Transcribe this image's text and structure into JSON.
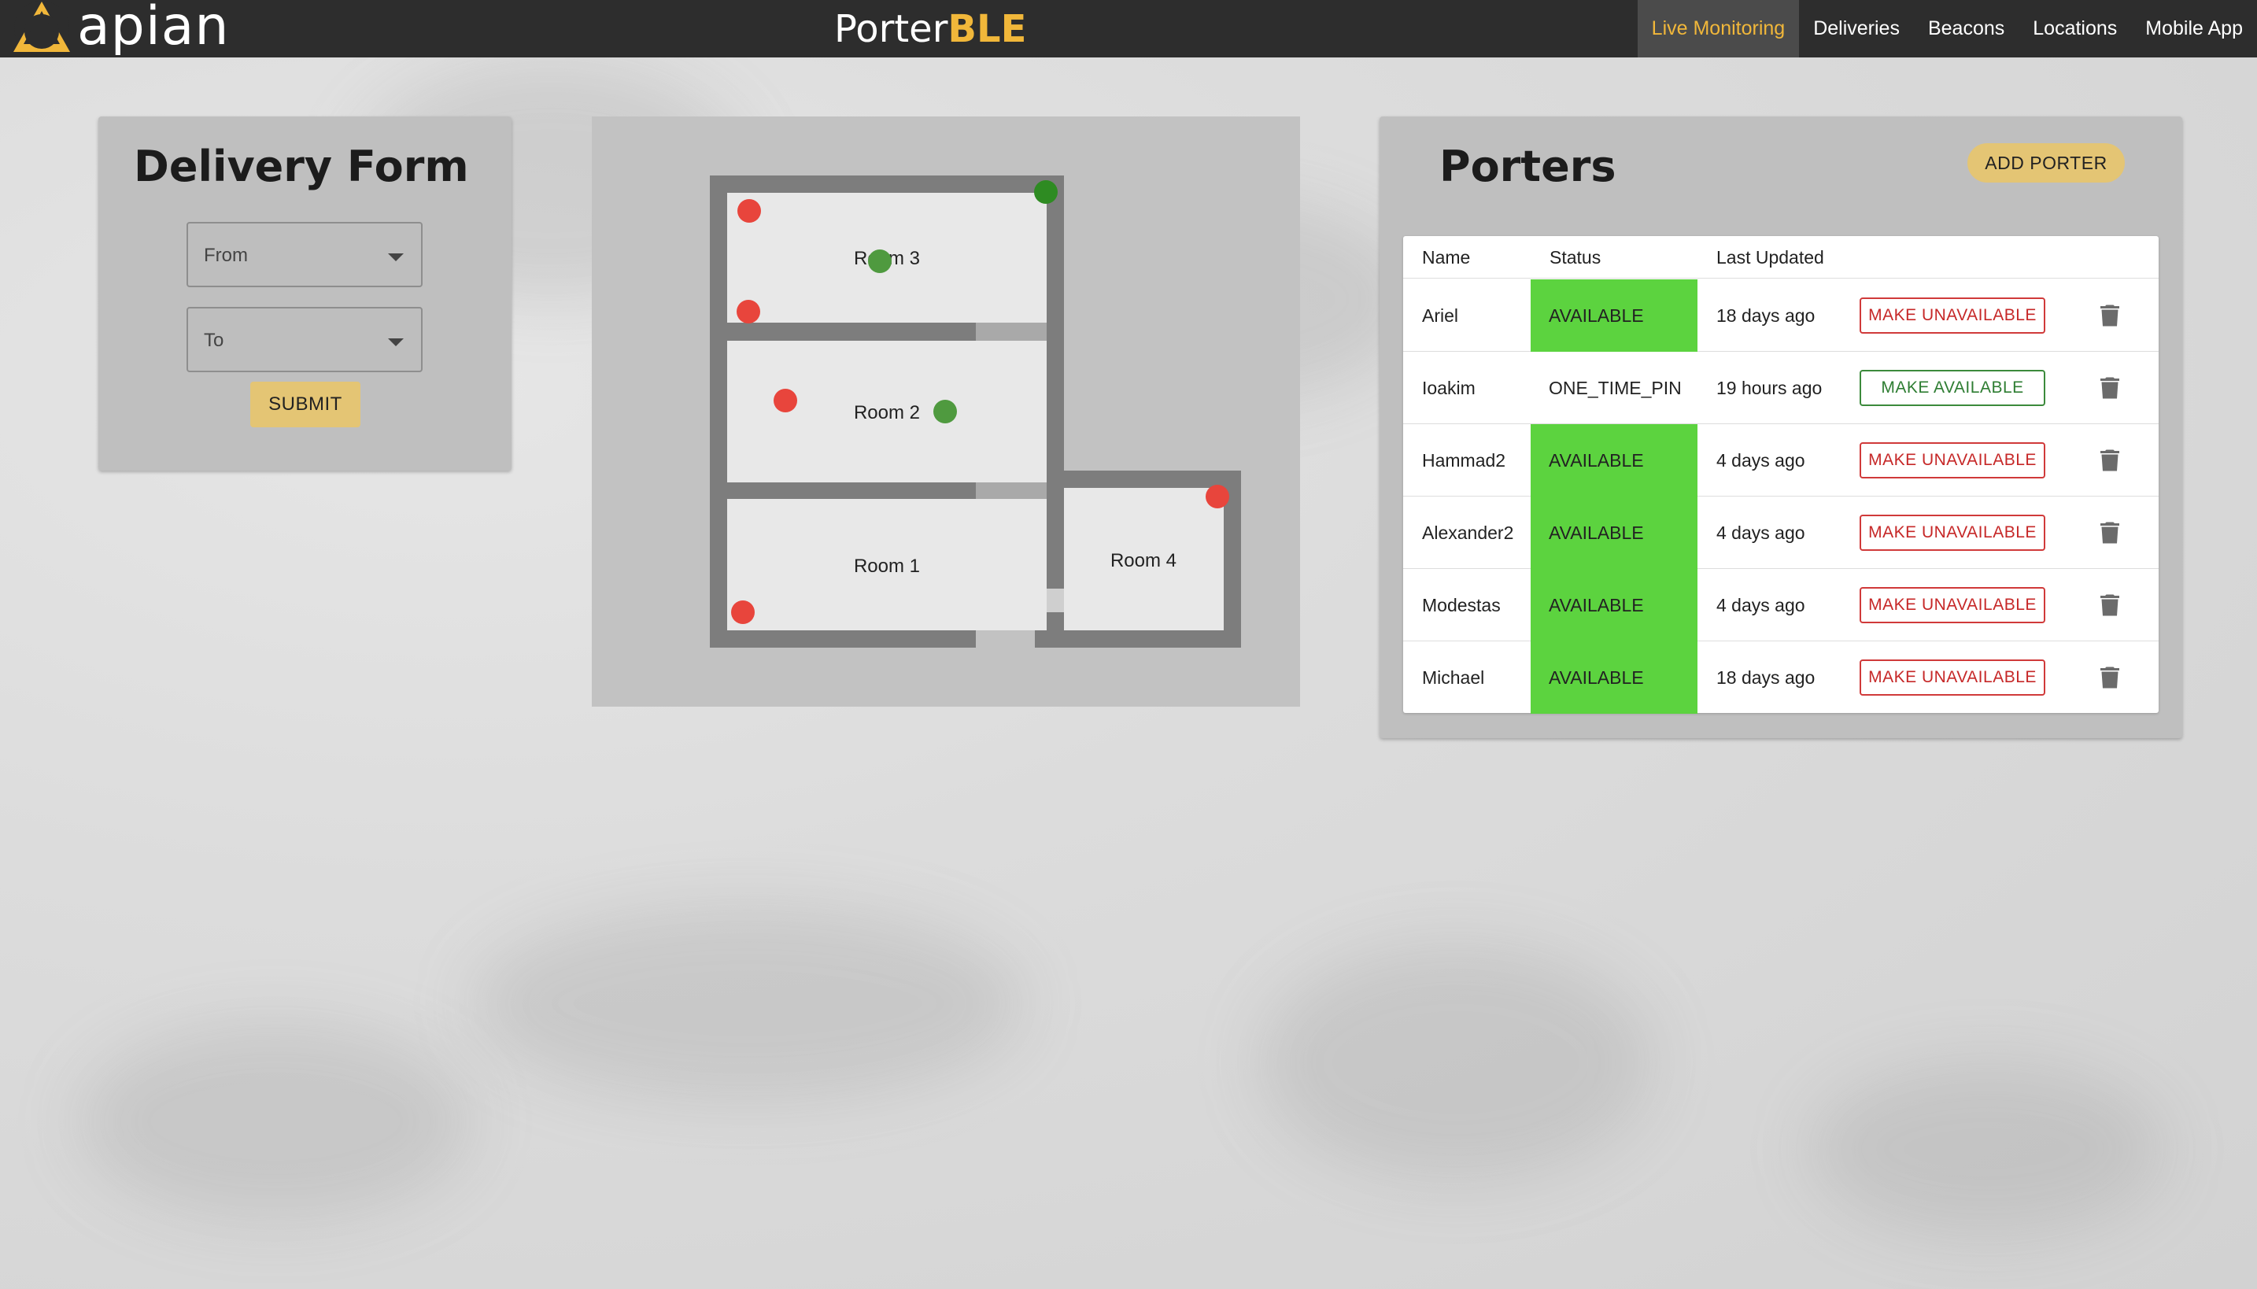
{
  "header": {
    "logo_text": "apian",
    "brand_part1": "Porter",
    "brand_part2": "BLE",
    "nav": [
      {
        "label": "Live Monitoring",
        "active": true
      },
      {
        "label": "Deliveries"
      },
      {
        "label": "Beacons"
      },
      {
        "label": "Locations"
      },
      {
        "label": "Mobile App"
      }
    ]
  },
  "delivery_form": {
    "title": "Delivery Form",
    "from_placeholder": "From",
    "to_placeholder": "To",
    "submit_label": "SUBMIT"
  },
  "map": {
    "rooms": [
      "Room 1",
      "Room 2",
      "Room 3",
      "Room 4"
    ],
    "marker_colors": {
      "red": "#e8453c",
      "green_light": "#4f9a3f",
      "green_dark": "#2e8b22"
    }
  },
  "porters": {
    "title": "Porters",
    "add_label": "ADD PORTER",
    "columns": [
      "Name",
      "Status",
      "Last Updated"
    ],
    "rows": [
      {
        "name": "Ariel",
        "status": "AVAILABLE",
        "updated": "18 days ago",
        "action": "MAKE UNAVAILABLE"
      },
      {
        "name": "Ioakim",
        "status": "ONE_TIME_PIN",
        "updated": "19 hours ago",
        "action": "MAKE AVAILABLE"
      },
      {
        "name": "Hammad2",
        "status": "AVAILABLE",
        "updated": "4 days ago",
        "action": "MAKE UNAVAILABLE"
      },
      {
        "name": "Alexander2",
        "status": "AVAILABLE",
        "updated": "4 days ago",
        "action": "MAKE UNAVAILABLE"
      },
      {
        "name": "Modestas",
        "status": "AVAILABLE",
        "updated": "4 days ago",
        "action": "MAKE UNAVAILABLE"
      },
      {
        "name": "Michael",
        "status": "AVAILABLE",
        "updated": "18 days ago",
        "action": "MAKE UNAVAILABLE"
      }
    ]
  },
  "colors": {
    "accent": "#f1b73a",
    "available": "#5cd33f",
    "topbar": "#2d2d2d"
  }
}
